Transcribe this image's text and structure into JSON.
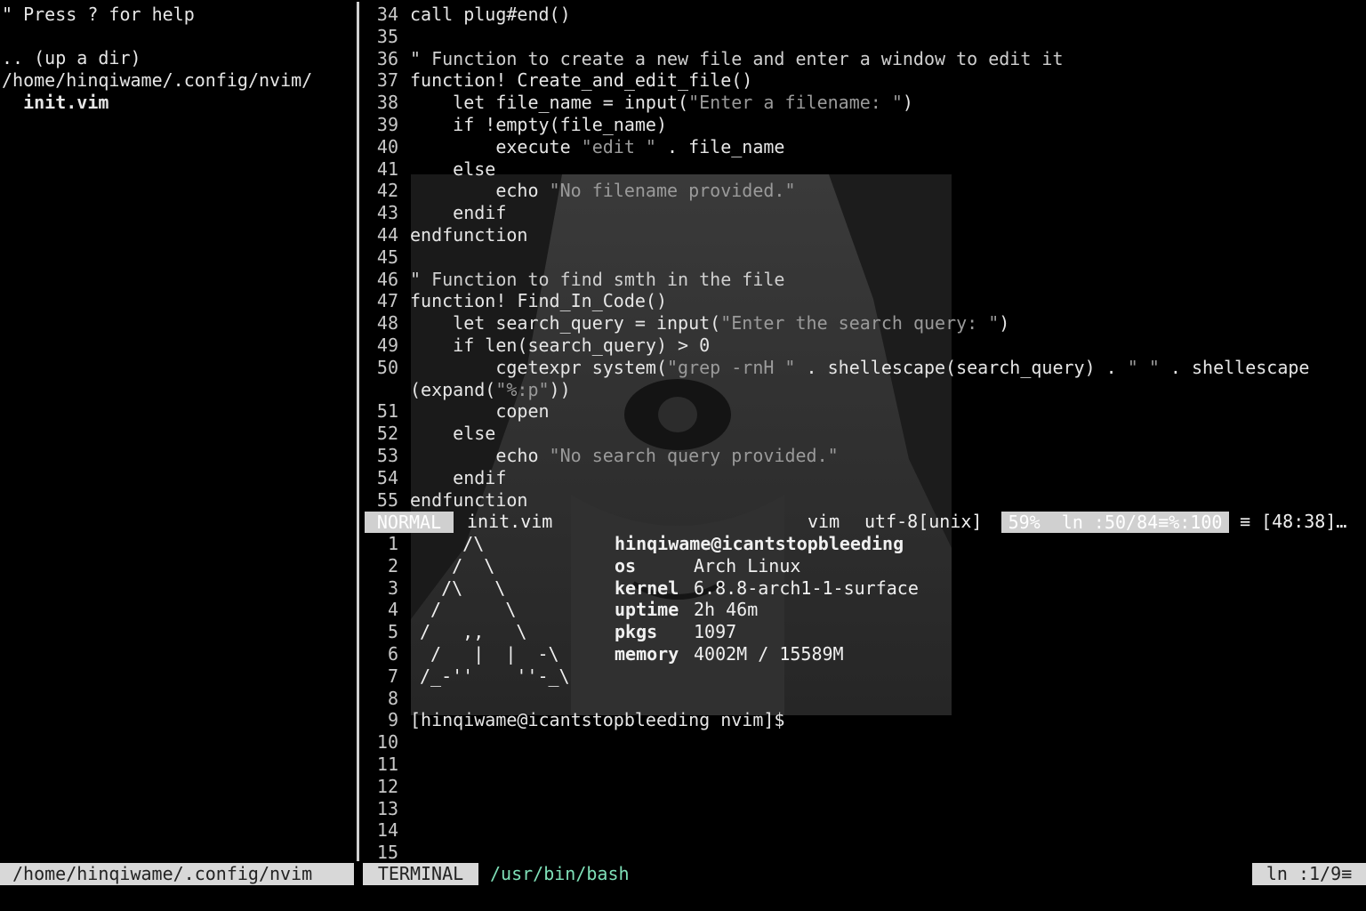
{
  "tree": {
    "help": "\" Press ? for help",
    "up_dir": ".. (up a dir)",
    "cwd": "/home/hinqiwame/.config/nvim/",
    "file": "  init.vim"
  },
  "editor": {
    "line_numbers": [
      "34",
      "35",
      "36",
      "37",
      "38",
      "39",
      "40",
      "41",
      "42",
      "43",
      "44",
      "45",
      "46",
      "47",
      "48",
      "49",
      "50",
      "",
      "51",
      "52",
      "53",
      "54",
      "55"
    ],
    "lines": [
      "call plug#end()",
      "",
      "\" Function to create a new file and enter a window to edit it",
      "function! Create_and_edit_file()",
      "    let file_name = input(\"Enter a filename: \")",
      "    if !empty(file_name)",
      "        execute \"edit \" . file_name",
      "    else",
      "        echo \"No filename provided.\"",
      "    endif",
      "endfunction",
      "",
      "\" Function to find smth in the file",
      "function! Find_In_Code()",
      "    let search_query = input(\"Enter the search query: \")",
      "    if len(search_query) > 0",
      "        cgetexpr system(\"grep -rnH \" . shellescape(search_query) . \" \" . shellescape",
      "(expand(\"%:p\"))",
      "        copen",
      "    else",
      "        echo \"No search query provided.\"",
      "    endif",
      "endfunction"
    ]
  },
  "statusline": {
    "mode": "NORMAL",
    "filename": "init.vim",
    "filetype": "vim",
    "encoding": "utf-8[unix]",
    "position": "59%  ln :50/84≡%:100",
    "trail": "≡ [48:38]…"
  },
  "terminal": {
    "line_numbers": [
      "1",
      "2",
      "3",
      "4",
      "5",
      "6",
      "7",
      "8",
      "9",
      "10",
      "11",
      "12",
      "13",
      "14",
      "15"
    ],
    "ascii": [
      "    /\\",
      "   /  \\",
      "  /\\   \\",
      " /      \\",
      "/   ,,   \\",
      " /   |  |  -\\",
      "/_-''    ''-_\\"
    ],
    "host": "hinqiwame@icantstopbleeding",
    "info": [
      {
        "key": "os",
        "value": "Arch Linux"
      },
      {
        "key": "kernel",
        "value": "6.8.8-arch1-1-surface"
      },
      {
        "key": "uptime",
        "value": "2h 46m"
      },
      {
        "key": "pkgs",
        "value": "1097"
      },
      {
        "key": "memory",
        "value": "4002M / 15589M"
      }
    ],
    "prompt": "[hinqiwame@icantstopbleeding nvim]$"
  },
  "bottom": {
    "tree_path": "/home/hinqiwame/.config/nvim",
    "term_tag": "TERMINAL",
    "term_path": "/usr/bin/bash",
    "term_pos": "ln :1/9≡"
  }
}
